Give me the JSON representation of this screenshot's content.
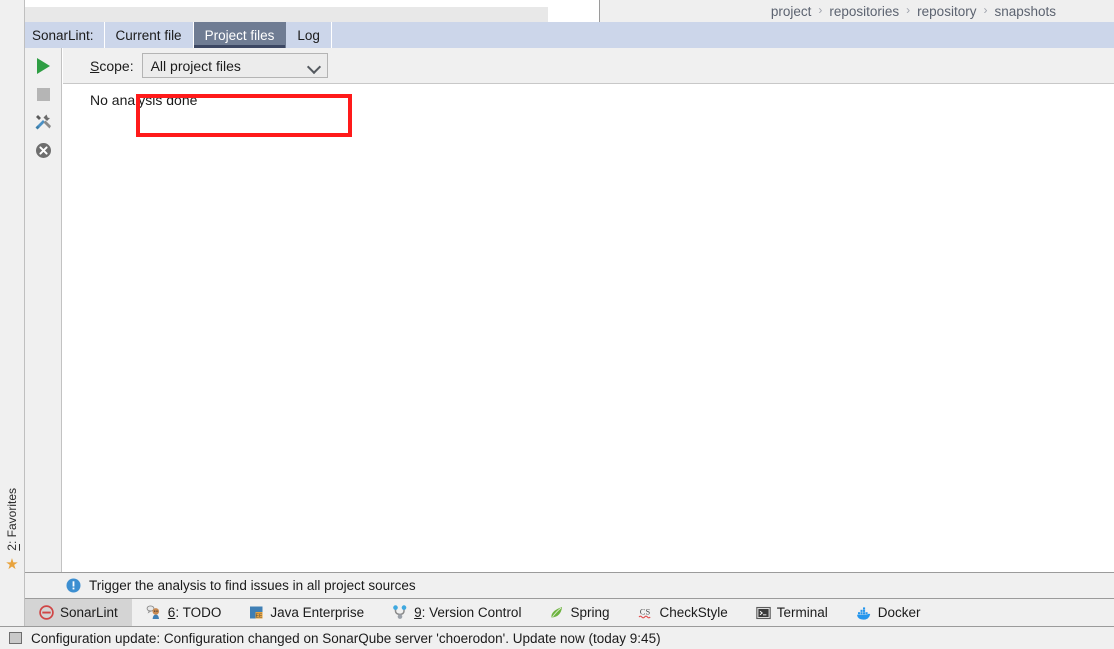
{
  "breadcrumb": {
    "separator": "›",
    "items": [
      "project",
      "repositories",
      "repository",
      "snapshots"
    ]
  },
  "tool_window": {
    "title": "SonarLint:",
    "tabs": [
      {
        "label": "Current file",
        "selected": false
      },
      {
        "label": "Project files",
        "selected": true
      },
      {
        "label": "Log",
        "selected": false
      }
    ]
  },
  "vertical_toolbar": {
    "buttons": [
      {
        "name": "run-analysis-button",
        "icon": "play-icon"
      },
      {
        "name": "stop-analysis-button",
        "icon": "stop-icon"
      },
      {
        "name": "configure-button",
        "icon": "tools-icon"
      },
      {
        "name": "clear-button",
        "icon": "cancel-circle-icon"
      }
    ]
  },
  "scope": {
    "label_prefix": "S",
    "label_rest": "cope:",
    "combo_value": "All project files",
    "chevron": "chevron-down-icon"
  },
  "main": {
    "status_message": "No analysis done"
  },
  "hint": {
    "icon": "info-icon",
    "text": "Trigger the analysis to find issues in all project sources"
  },
  "bottom_tool_tabs": [
    {
      "label": "SonarLint",
      "icon": "sonarlint-icon",
      "mnemonic": "",
      "selected": true
    },
    {
      "label": ": TODO",
      "icon": "todo-icon",
      "mnemonic": "6",
      "selected": false
    },
    {
      "label": "Java Enterprise",
      "icon": "java-enterprise-icon",
      "mnemonic": "",
      "selected": false
    },
    {
      "label": ": Version Control",
      "icon": "version-control-icon",
      "mnemonic": "9",
      "selected": false
    },
    {
      "label": "Spring",
      "icon": "spring-leaf-icon",
      "mnemonic": "",
      "selected": false
    },
    {
      "label": "CheckStyle",
      "icon": "checkstyle-icon",
      "mnemonic": "",
      "selected": false
    },
    {
      "label": "Terminal",
      "icon": "terminal-icon",
      "mnemonic": "",
      "selected": false
    },
    {
      "label": "Docker",
      "icon": "docker-icon",
      "mnemonic": "",
      "selected": false
    }
  ],
  "favorites_stripe": {
    "mnemonic": "2",
    "label": ": Favorites",
    "icon": "star-icon"
  },
  "status": {
    "icon": "monitor-icon",
    "text": "Configuration update: Configuration changed on SonarQube server 'choerodon'. Update now (today 9:45)"
  },
  "colors": {
    "annotation": "#ff1a1a",
    "selected_tab_bg": "#6f7c93",
    "tab_row_bg": "#ccd6ea",
    "panel_bg": "#f0f0f0"
  }
}
